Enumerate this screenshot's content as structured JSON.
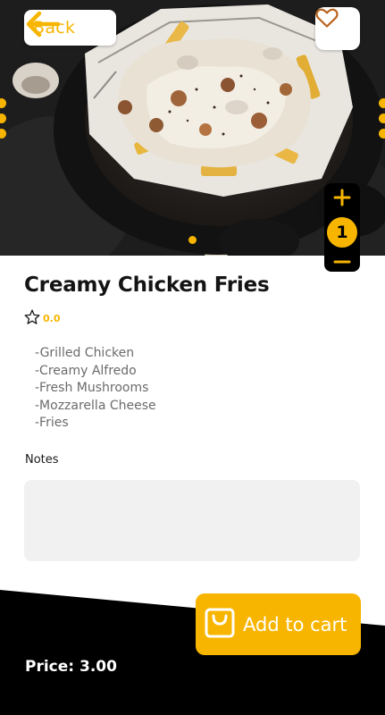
{
  "header": {
    "back_label": "Back",
    "back_icon": "arrow-left-icon",
    "favorite_icon": "heart-outline-icon"
  },
  "hero": {
    "image": "food-photo",
    "carousel_pages": 1
  },
  "quantity": {
    "value": "1",
    "increment_icon": "plus-icon",
    "decrement_icon": "minus-icon"
  },
  "product": {
    "name": "Creamy Chicken Fries",
    "rating_icon": "star-outline-icon",
    "rating": "0.0",
    "ingredients": [
      "-Grilled Chicken",
      "-Creamy Alfredo",
      "-Fresh Mushrooms",
      "-Mozzarella Cheese",
      "-Fries"
    ]
  },
  "notes": {
    "label": "Notes",
    "value": "",
    "placeholder": ""
  },
  "cart": {
    "label": "Add to cart",
    "icon": "shopping-bag-icon"
  },
  "price": {
    "text": "Price: 3.00"
  },
  "colors": {
    "accent": "#f7b500",
    "dark": "#000000",
    "notes_bg": "#f1f1f1",
    "ingredient_text": "#6b6b6b"
  }
}
